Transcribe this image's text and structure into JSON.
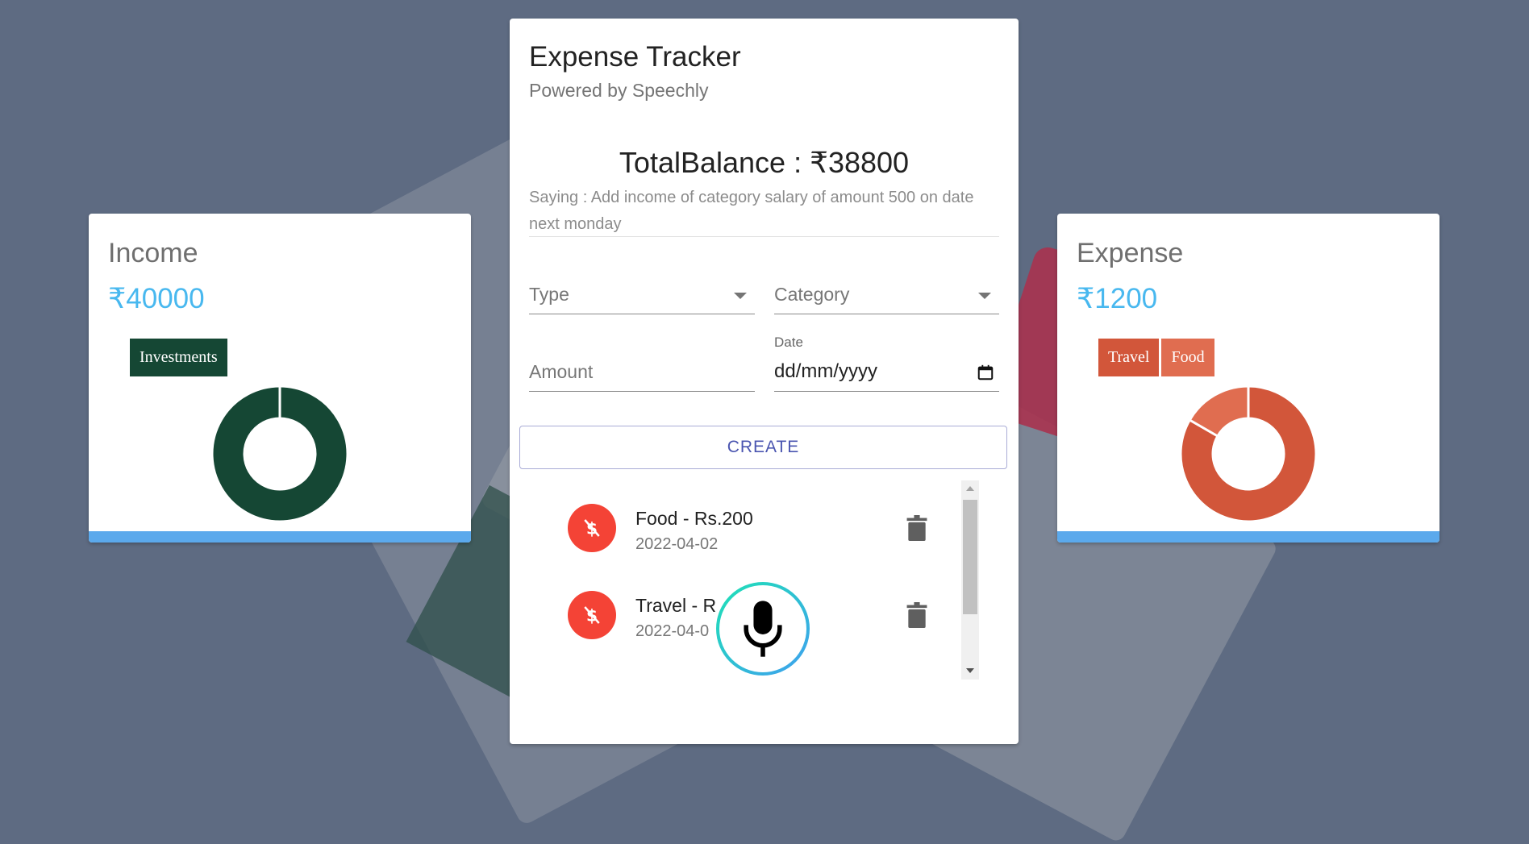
{
  "app": {
    "title": "Expense Tracker",
    "subtitle": "Powered by Speechly",
    "balance": "TotalBalance : ₹38800",
    "saying": "Saying : Add income of category salary of amount 500 on date next monday"
  },
  "form": {
    "type_label": "Type",
    "category_label": "Category",
    "amount_label": "Amount",
    "date_label": "Date",
    "date_value": "dd/mm/yyyy",
    "create_label": "CREATE"
  },
  "transactions": [
    {
      "title": "Food - Rs.200",
      "date": "2022-04-02"
    },
    {
      "title": "Travel - R",
      "date": "2022-04-0"
    }
  ],
  "income": {
    "title": "Income",
    "amount": "₹40000",
    "legend": [
      {
        "label": "Investments",
        "color": "#154734"
      }
    ],
    "slices": [
      {
        "label": "Investments",
        "value": 40000,
        "color": "#154734"
      }
    ]
  },
  "expense": {
    "title": "Expense",
    "amount": "₹1200",
    "legend": [
      {
        "label": "Travel",
        "color": "#d2563a"
      },
      {
        "label": "Food",
        "color": "#e06d50"
      }
    ],
    "slices": [
      {
        "label": "Travel",
        "value": 1000,
        "color": "#d2563a"
      },
      {
        "label": "Food",
        "value": 200,
        "color": "#e06d50"
      }
    ]
  },
  "colors": {
    "accent_blue": "#48b8ef",
    "bar_blue": "#5ba9ec",
    "delete_red": "#f44336",
    "create_text": "#4a55b0"
  },
  "icons": {
    "avatar": "money-off-icon",
    "delete": "trash-icon",
    "mic": "microphone-icon",
    "date": "calendar-icon"
  }
}
